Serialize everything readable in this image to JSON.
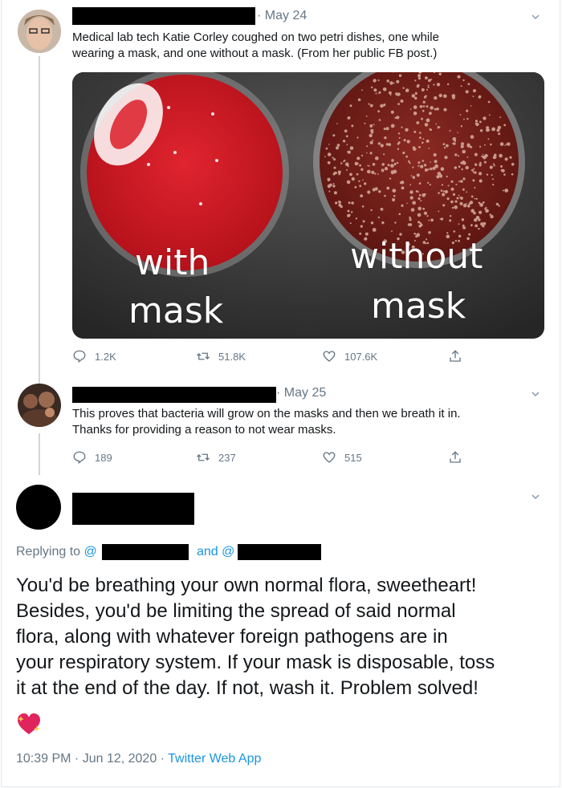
{
  "tweet1": {
    "date": "May 24",
    "text_line1": "Medical lab tech Katie Corley coughed on two petri dishes, one while",
    "text_line2": "wearing a mask, and one without a mask. (From her public FB post.)",
    "media": {
      "left_label_1": "with",
      "left_label_2": "mask",
      "right_label_1": "without",
      "right_label_2": "mask"
    },
    "replies": "1.2K",
    "retweets": "51.8K",
    "likes": "107.6K"
  },
  "tweet2": {
    "date": "May 25",
    "text_line1": "This proves that bacteria will grow on the masks and then we breath it in.",
    "text_line2": "Thanks for providing a reason to not wear masks.",
    "replies": "189",
    "retweets": "237",
    "likes": "515"
  },
  "main_tweet": {
    "replying_to_prefix": "Replying to",
    "replying_at1": "@",
    "replying_and": "and",
    "replying_at2": "@",
    "text_lines": [
      "You'd be breathing your own normal flora, sweetheart!",
      "Besides, you'd be limiting the spread of said normal",
      "flora, along with whatever foreign pathogens are in",
      "your respiratory system. If your mask is disposable, toss",
      "it at the end of the day. If not, wash it. Problem solved!"
    ],
    "emoji": "💖",
    "timestamp": "10:39 PM · Jun 12, 2020 ·",
    "source": "Twitter Web App"
  },
  "icons": {
    "reply": "reply-icon",
    "retweet": "retweet-icon",
    "like": "heart-icon",
    "share": "share-icon",
    "more": "chevron-down-icon"
  },
  "colors": {
    "meta_gray": "#657786",
    "link_blue": "#1b95e0",
    "thread_line": "#ccd6dd"
  }
}
